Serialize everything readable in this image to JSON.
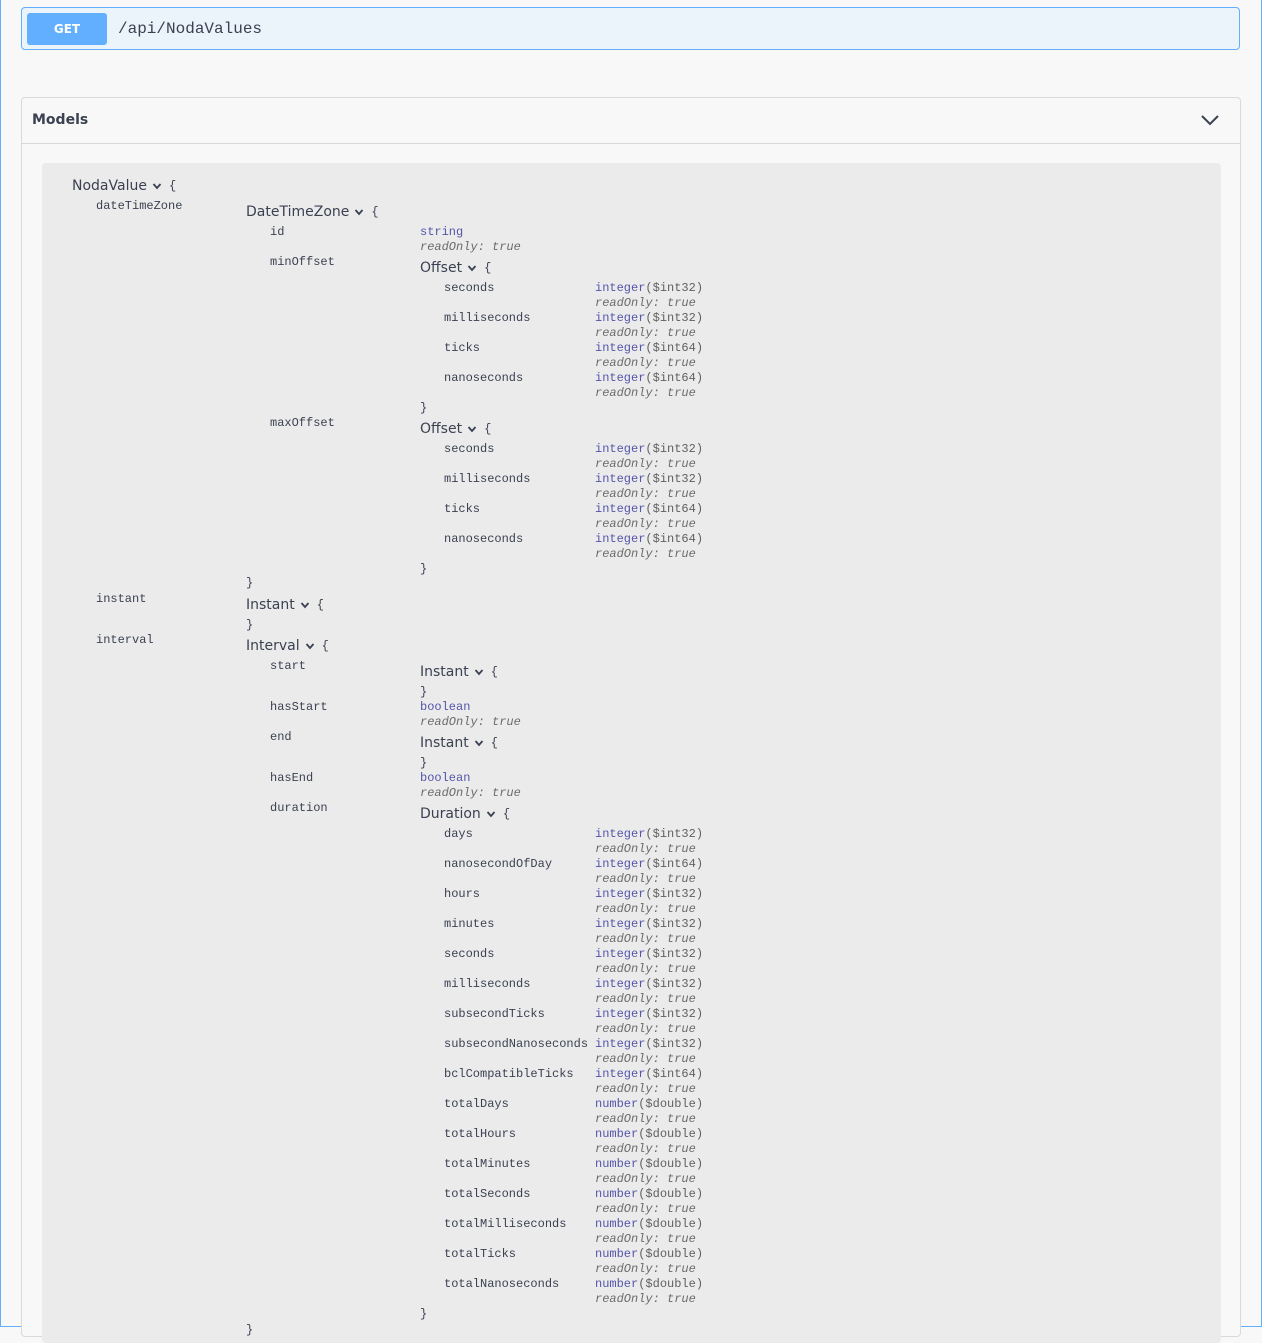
{
  "endpoint": {
    "method": "GET",
    "path": "/api/NodaValues"
  },
  "models_section": {
    "title": "Models",
    "toggle_icon": "chevron-down-icon"
  },
  "symbols": {
    "open": "{",
    "close": "}",
    "readonly": "readOnly: true"
  },
  "types": {
    "string": "string",
    "integer": "integer",
    "boolean": "boolean",
    "number": "number",
    "int32": "($int32)",
    "int64": "($int64)",
    "double": "($double)"
  },
  "model": {
    "name": "NodaValue",
    "props": {
      "dateTimeZone": "dateTimeZone",
      "instant": "instant",
      "interval": "interval"
    },
    "dateTimeZone": {
      "name": "DateTimeZone",
      "props": {
        "id": "id",
        "minOffset": "minOffset",
        "maxOffset": "maxOffset"
      },
      "offset_name": "Offset",
      "offset_props": {
        "seconds": "seconds",
        "milliseconds": "milliseconds",
        "ticks": "ticks",
        "nanoseconds": "nanoseconds"
      }
    },
    "instant": {
      "name": "Instant"
    },
    "interval": {
      "name": "Interval",
      "props": {
        "start": "start",
        "hasStart": "hasStart",
        "end": "end",
        "hasEnd": "hasEnd",
        "duration": "duration"
      },
      "duration": {
        "name": "Duration",
        "props": [
          "days",
          "nanosecondOfDay",
          "hours",
          "minutes",
          "seconds",
          "milliseconds",
          "subsecondTicks",
          "subsecondNanoseconds",
          "bclCompatibleTicks",
          "totalDays",
          "totalHours",
          "totalMinutes",
          "totalSeconds",
          "totalMilliseconds",
          "totalTicks",
          "totalNanoseconds"
        ]
      }
    }
  }
}
